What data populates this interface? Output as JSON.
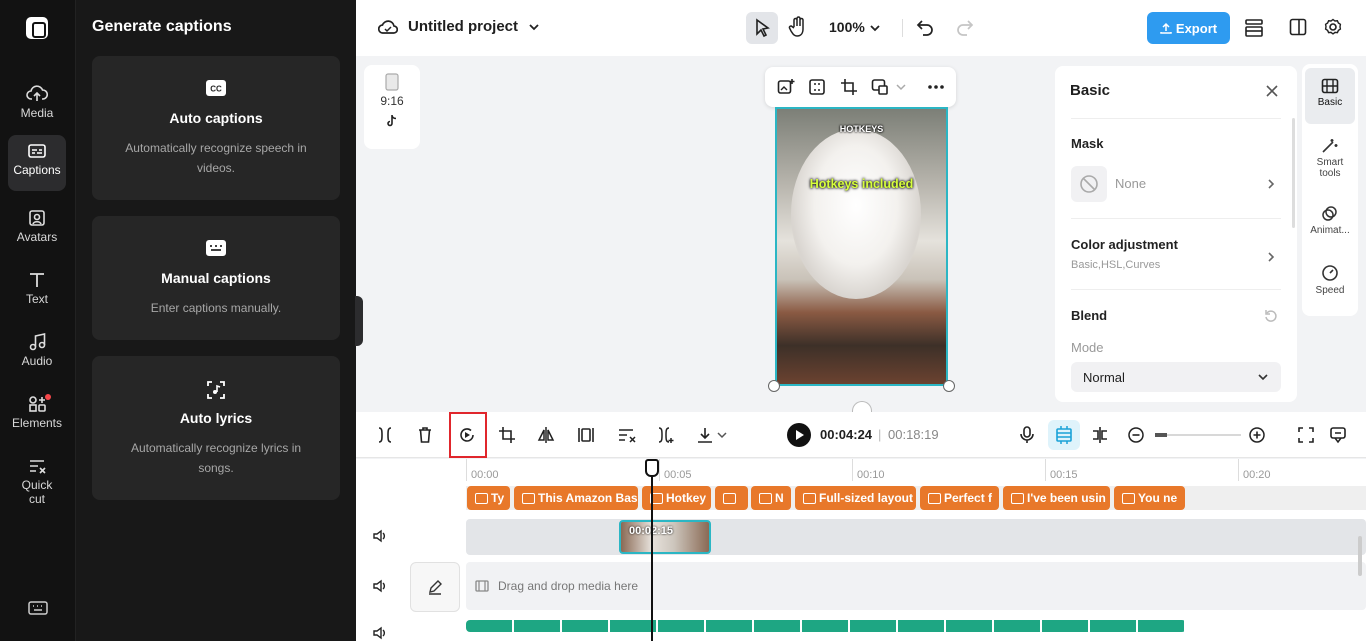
{
  "rail": {
    "items": [
      {
        "label": "Media",
        "icon": "cloud-upload-icon"
      },
      {
        "label": "Captions",
        "icon": "captions-icon",
        "active": true
      },
      {
        "label": "Avatars",
        "icon": "avatar-icon"
      },
      {
        "label": "Text",
        "icon": "text-icon"
      },
      {
        "label": "Audio",
        "icon": "music-icon"
      },
      {
        "label": "Elements",
        "icon": "elements-icon",
        "badge": true
      },
      {
        "label": "Quick",
        "label2": "cut",
        "icon": "quick-cut-icon"
      }
    ]
  },
  "panel": {
    "title": "Generate captions",
    "cards": [
      {
        "title": "Auto captions",
        "desc": "Automatically recognize speech in videos.",
        "icon": "cc-icon"
      },
      {
        "title": "Manual captions",
        "desc": "Enter captions manually.",
        "icon": "keyboard-icon"
      },
      {
        "title": "Auto lyrics",
        "desc": "Automatically recognize lyrics in songs.",
        "icon": "lyrics-icon"
      }
    ]
  },
  "topbar": {
    "project_name": "Untitled project",
    "zoom": "100%",
    "export_label": "Export"
  },
  "aspect": {
    "ratio": "9:16",
    "platform_icon": "tiktok-icon"
  },
  "video": {
    "watermark": "HOTKEYS",
    "caption": "Hotkeys included"
  },
  "props": {
    "title": "Basic",
    "mask_label": "Mask",
    "mask_value": "None",
    "color_label": "Color adjustment",
    "color_sub": "Basic,HSL,Curves",
    "blend_label": "Blend",
    "mode_label": "Mode",
    "mode_value": "Normal"
  },
  "right_rail": [
    {
      "label": "Basic",
      "icon": "basic-icon",
      "active": true
    },
    {
      "label": "Smart",
      "label2": "tools",
      "icon": "magic-wand-icon"
    },
    {
      "label": "Animat...",
      "icon": "animation-icon"
    },
    {
      "label": "Speed",
      "icon": "speed-icon"
    }
  ],
  "timeline": {
    "current_time": "00:04:24",
    "total_time": "00:18:19",
    "separator": "|",
    "ruler": [
      "00:00",
      "00:05",
      "00:10",
      "00:15",
      "00:20"
    ],
    "captions": [
      "Ty",
      "This Amazon Bas",
      "Hotkey",
      "",
      "N",
      "Full-sized layout",
      "Perfect f",
      "I've been usin",
      "You ne"
    ],
    "video_clip_time": "00:02:15",
    "drop_text": "Drag and drop media here"
  },
  "colors": {
    "accent": "#2e9bf0",
    "caption_clip": "#e8782a",
    "selection": "#2bb6c4",
    "audio": "#1ea683",
    "highlight": "#e0262c"
  }
}
